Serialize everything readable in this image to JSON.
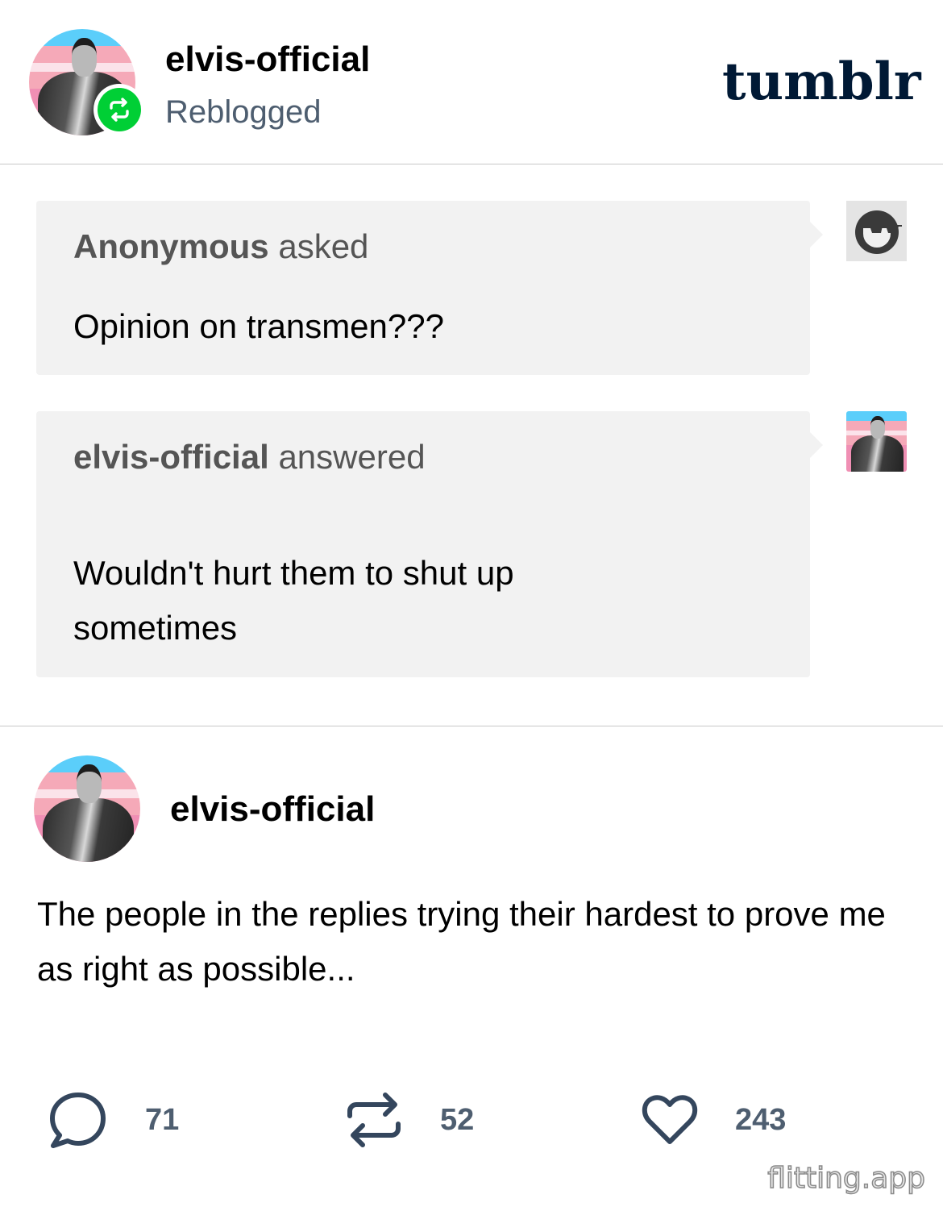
{
  "header": {
    "username": "elvis-official",
    "status": "Reblogged",
    "logo": "tumblr",
    "badge_icon": "reblog-icon",
    "badge_color": "#00cf35"
  },
  "ask": {
    "asker": "Anonymous",
    "verb": "asked",
    "question": "Opinion on transmen???"
  },
  "answer": {
    "answerer": "elvis-official",
    "verb": "answered",
    "text": "Wouldn't hurt them to shut up sometimes"
  },
  "reblog_post": {
    "username": "elvis-official",
    "body": "The people in the replies trying their hardest to prove me as right as possible..."
  },
  "actions": {
    "replies": {
      "icon": "comment-icon",
      "count": "71"
    },
    "reblogs": {
      "icon": "reblog-icon",
      "count": "52"
    },
    "likes": {
      "icon": "heart-icon",
      "count": "243"
    }
  },
  "watermark": "flitting.app",
  "colors": {
    "muted_text": "#4e5e70",
    "bubble_bg": "#f2f2f2",
    "logo": "#001935"
  }
}
